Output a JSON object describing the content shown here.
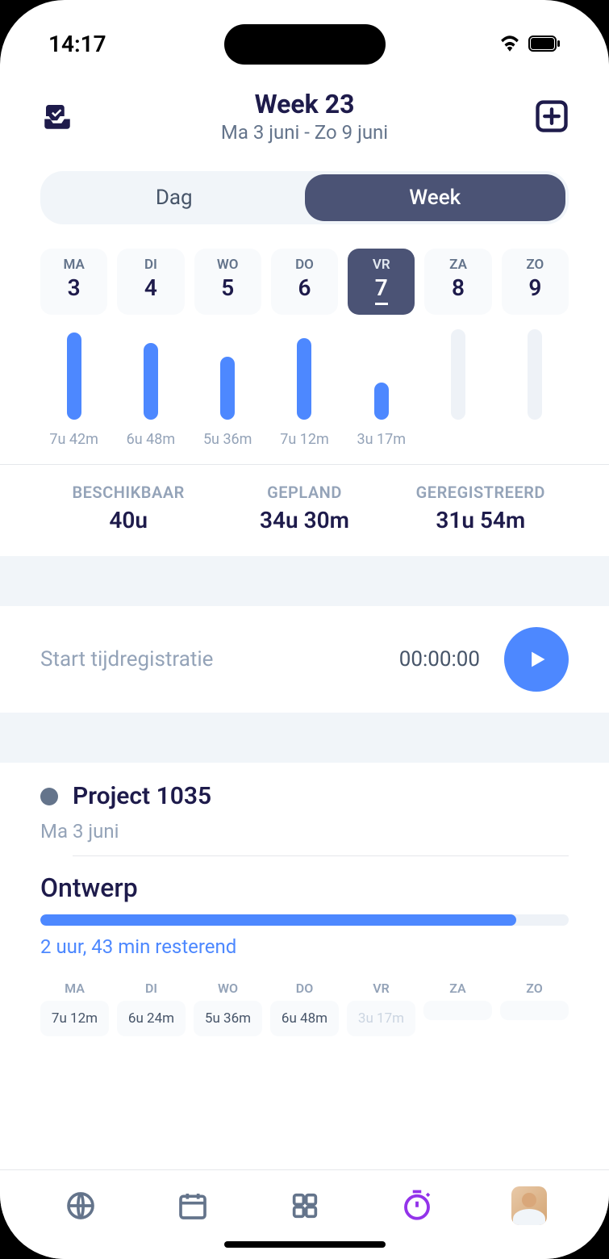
{
  "status": {
    "time": "14:17"
  },
  "header": {
    "title": "Week 23",
    "subtitle": "Ma 3 juni - Zo 9 juni"
  },
  "tabs": {
    "day": "Dag",
    "week": "Week"
  },
  "days": [
    {
      "abbr": "MA",
      "num": "3"
    },
    {
      "abbr": "DI",
      "num": "4"
    },
    {
      "abbr": "WO",
      "num": "5"
    },
    {
      "abbr": "DO",
      "num": "6"
    },
    {
      "abbr": "VR",
      "num": "7"
    },
    {
      "abbr": "ZA",
      "num": "8"
    },
    {
      "abbr": "ZO",
      "num": "9"
    }
  ],
  "bar_labels": [
    "7u 42m",
    "6u 48m",
    "5u 36m",
    "7u 12m",
    "3u 17m",
    "",
    ""
  ],
  "stats": {
    "available_label": "BESCHIKBAAR",
    "available_value": "40u",
    "planned_label": "GEPLAND",
    "planned_value": "34u 30m",
    "registered_label": "GEREGISTREERD",
    "registered_value": "31u 54m"
  },
  "timer": {
    "label": "Start tijdregistratie",
    "time": "00:00:00"
  },
  "project": {
    "name": "Project 1035",
    "date": "Ma 3 juni"
  },
  "task": {
    "name": "Ontwerp",
    "remaining": "2 uur, 43 min resterend",
    "progress_pct": 90
  },
  "mini_days": [
    {
      "abbr": "MA",
      "val": "7u 12m",
      "state": "normal"
    },
    {
      "abbr": "DI",
      "val": "6u 24m",
      "state": "normal"
    },
    {
      "abbr": "WO",
      "val": "5u 36m",
      "state": "normal"
    },
    {
      "abbr": "DO",
      "val": "6u 48m",
      "state": "normal"
    },
    {
      "abbr": "VR",
      "val": "3u 17m",
      "state": "muted"
    },
    {
      "abbr": "ZA",
      "val": " ",
      "state": "empty"
    },
    {
      "abbr": "ZO",
      "val": " ",
      "state": "empty"
    }
  ],
  "chart_data": {
    "type": "bar",
    "categories": [
      "MA",
      "DI",
      "WO",
      "DO",
      "VR",
      "ZA",
      "ZO"
    ],
    "values_minutes": [
      462,
      408,
      336,
      432,
      197,
      0,
      0
    ],
    "value_labels": [
      "7u 42m",
      "6u 48m",
      "5u 36m",
      "7u 12m",
      "3u 17m",
      "",
      ""
    ],
    "title": "",
    "xlabel": "",
    "ylabel": "",
    "ylim": [
      0,
      480
    ]
  }
}
